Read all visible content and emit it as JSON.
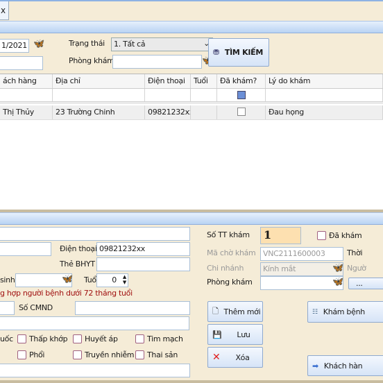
{
  "tab": {
    "label": "x"
  },
  "search": {
    "date_value": "1/2021",
    "status_label": "Trạng thái",
    "status_value": "1. Tất cả",
    "room_label": "Phòng khám",
    "room_value": "",
    "search_button": "TÌM KIẾM"
  },
  "grid": {
    "columns": [
      "ách hàng",
      "Địa chỉ",
      "Điện thoại",
      "Tuổi",
      "Đã khám?",
      "Lý do khám"
    ],
    "rows": [
      {
        "name": "Thị Thủy",
        "address": "23 Trường Chinh",
        "phone": "09821232xx",
        "age": "",
        "examined": false,
        "reason": "Đau họng"
      }
    ]
  },
  "form": {
    "phone_label": "Điện thoại",
    "phone_value": "09821232xx",
    "bhyt_label": "Thẻ BHYT",
    "dob_label": "sinh",
    "age_label": "Tuổi",
    "age_value": "0",
    "note": "g hợp người bệnh dưới 72 tháng tuổi",
    "cmnd_label": "Số CMND",
    "conditions": [
      "uốc",
      "Thấp khớp",
      "Huyết áp",
      "Tim mạch",
      "Phổi",
      "Truyền nhiễm",
      "Thai sản"
    ],
    "queue_label": "Số TT khám",
    "queue_value": "1",
    "examined_label": "Đã khám",
    "wait_code_label": "Mã chờ khám",
    "wait_code_value": "VNC2111600003",
    "time_label": "Thời",
    "branch_label": "Chi nhánh",
    "branch_value": "Kính mắt",
    "person_label": "Ngườ",
    "room_label": "Phòng khám",
    "more_button": "...",
    "buttons": {
      "new": "Thêm mới",
      "save": "Lưu",
      "delete": "Xóa",
      "examine": "Khám bệnh",
      "customer": "Khách hàn"
    }
  },
  "colors": {
    "background": "#f5ecd7",
    "queue_box": "#fde0b0",
    "note": "#a01010"
  }
}
